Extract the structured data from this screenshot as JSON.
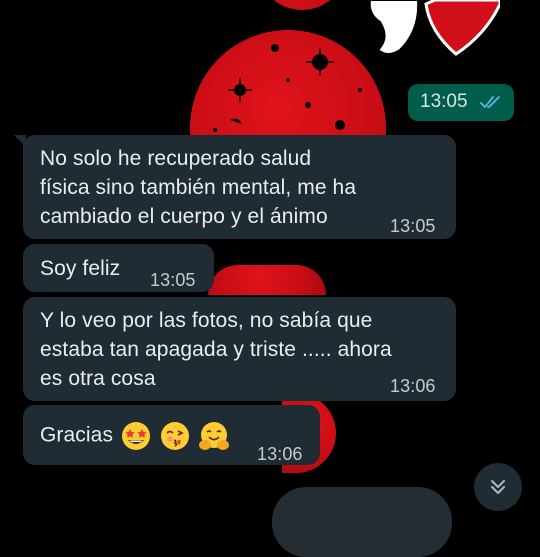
{
  "wallpaper": {
    "colors": {
      "accent": "#d10f18",
      "sticker_outline": "#ffffff"
    }
  },
  "messages": [
    {
      "direction": "outgoing",
      "time": "13:05",
      "status": "read",
      "status_icon": "double-check-icon"
    },
    {
      "direction": "incoming",
      "lines": [
        "No solo he recuperado salud",
        "física sino también mental, me ha",
        "cambiado el cuerpo y el ánimo"
      ],
      "time": "13:05"
    },
    {
      "direction": "incoming",
      "lines": [
        "Soy feliz"
      ],
      "time": "13:05"
    },
    {
      "direction": "incoming",
      "lines": [
        "Y lo veo por las fotos, no sabía que",
        "estaba tan apagada y triste ..... ahora",
        "es otra cosa"
      ],
      "time": "13:06"
    },
    {
      "direction": "incoming",
      "text": "Gracias",
      "emojis": [
        "star-struck-emoji",
        "face-blowing-kiss-emoji",
        "hugging-face-emoji"
      ],
      "time": "13:06"
    }
  ],
  "scroll_button": {
    "icon": "chevron-double-down-icon"
  },
  "colors": {
    "incoming_bubble": "#1f2c34",
    "outgoing_bubble": "#005c4b",
    "read_ticks": "#53bdeb",
    "text": "#e9edef"
  }
}
